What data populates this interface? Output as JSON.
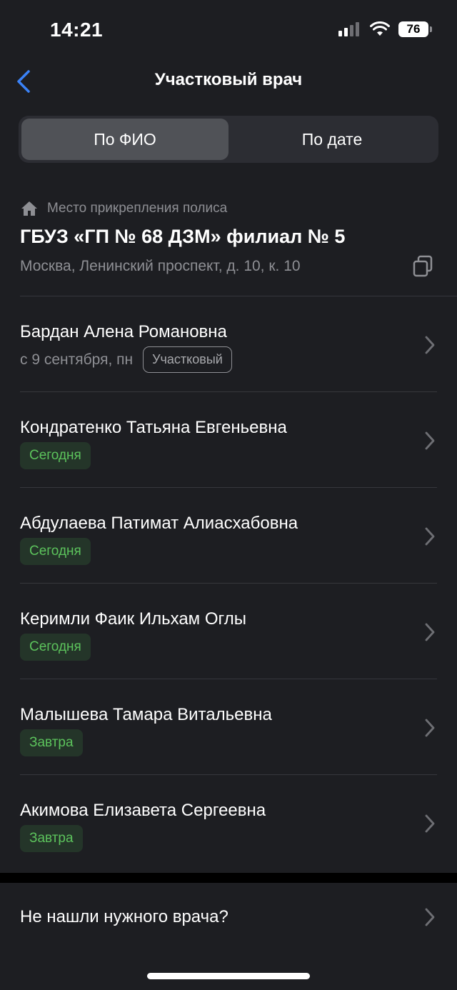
{
  "status_bar": {
    "time": "14:21",
    "battery": "76"
  },
  "header": {
    "title": "Участковый врач"
  },
  "tabs": [
    {
      "label": "По ФИО",
      "active": true
    },
    {
      "label": "По дате",
      "active": false
    }
  ],
  "policy": {
    "label": "Место прикрепления полиса",
    "name": "ГБУЗ «ГП № 68 ДЗМ» филиал № 5",
    "address": "Москва, Ленинский проспект, д. 10, к. 10"
  },
  "doctors": [
    {
      "name": "Бардан Алена Романовна",
      "date": "с 9 сентября, пн",
      "badge": "Участковый"
    },
    {
      "name": "Кондратенко Татьяна Евгеньевна",
      "badge": "Сегодня"
    },
    {
      "name": "Абдулаева Патимат Алиасхабовна",
      "badge": "Сегодня"
    },
    {
      "name": "Керимли Фаик Ильхам Оглы",
      "badge": "Сегодня"
    },
    {
      "name": "Малышева Тамара Витальевна",
      "badge": "Завтра"
    },
    {
      "name": "Акимова Елизавета Сергеевна",
      "badge": "Завтра"
    }
  ],
  "footer": {
    "not_found": "Не нашли нужного врача?"
  },
  "colors": {
    "accent": "#3a82f7",
    "background": "#1d1e22",
    "success": "#5cc35c"
  }
}
